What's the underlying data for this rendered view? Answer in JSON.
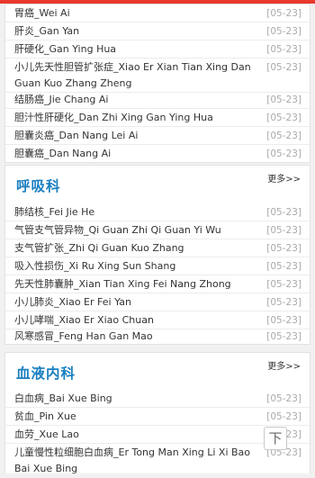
{
  "group1": {
    "items": [
      {
        "title": "胃癌_Wei Ai",
        "date": "[05-23]"
      },
      {
        "title": "肝炎_Gan Yan",
        "date": "[05-23]"
      },
      {
        "title": "肝硬化_Gan Ying Hua",
        "date": "[05-23]"
      },
      {
        "title": "小儿先天性胆管扩张症_Xiao Er Xian Tian Xing Dan Guan Kuo Zhang Zheng",
        "date": "[05-23]"
      },
      {
        "title": "结肠癌_Jie Chang Ai",
        "date": "[05-23]"
      },
      {
        "title": "胆汁性肝硬化_Dan Zhi Xing Gan Ying Hua",
        "date": "[05-23]"
      },
      {
        "title": "胆囊炎癌_Dan Nang Lei Ai",
        "date": "[05-23]"
      },
      {
        "title": "胆囊癌_Dan Nang Ai",
        "date": "[05-23]"
      }
    ]
  },
  "respiratory": {
    "title": "呼吸科",
    "more": "更多>>",
    "items": [
      {
        "title": "肺结核_Fei Jie He",
        "date": "[05-23]"
      },
      {
        "title": "气管支气管异物_Qi Guan Zhi Qi Guan Yi Wu",
        "date": "[05-23]"
      },
      {
        "title": "支气管扩张_Zhi Qi Guan Kuo Zhang",
        "date": "[05-23]"
      },
      {
        "title": "吸入性损伤_Xi Ru Xing Sun Shang",
        "date": "[05-23]"
      },
      {
        "title": "先天性肺囊肿_Xian Tian Xing Fei Nang Zhong",
        "date": "[05-23]"
      },
      {
        "title": "小儿肺炎_Xiao Er Fei Yan",
        "date": "[05-23]"
      },
      {
        "title": "小儿哮喘_Xiao Er Xiao Chuan",
        "date": "[05-23]"
      },
      {
        "title": "风寒感冒_Feng Han Gan Mao",
        "date": "[05-23]"
      }
    ]
  },
  "hematology": {
    "title": "血液内科",
    "more": "更多>>",
    "items": [
      {
        "title": "白血病_Bai Xue Bing",
        "date": "[05-23]"
      },
      {
        "title": "贫血_Pin Xue",
        "date": "[05-23]"
      },
      {
        "title": "血劳_Xue Lao",
        "date": "[05-23]"
      },
      {
        "title": "儿童慢性粒细胞白血病_Er Tong Man Xing Li Xi Bao Bai Xue Bing",
        "date": "[05-23]"
      }
    ]
  },
  "back_to_top": "下"
}
